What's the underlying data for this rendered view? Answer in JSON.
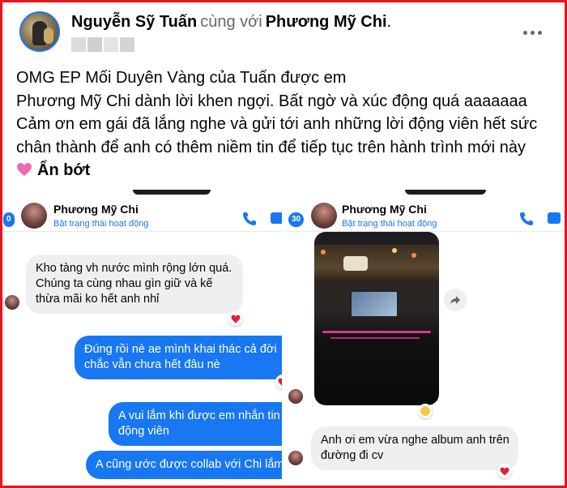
{
  "post": {
    "author": "Nguyễn Sỹ Tuấn",
    "with_word": "cùng với",
    "co_author": "Phương Mỹ Chi",
    "end_dot": ".",
    "text_lines": [
      "OMG EP Mối Duyên Vàng của Tuấn được em",
      "Phương Mỹ Chi dành lời khen ngợi. Bất ngờ và xúc động quá aaaaaaa",
      "Cảm ơn em gái đã lắng nghe và gửi tới anh những lời động viên hết sức",
      "chân thành để anh có thêm niềm tin để tiếp tục trên hành trình mới này"
    ],
    "see_less": "Ẩn bớt",
    "frame_color": "#e5161c"
  },
  "left_screenshot": {
    "back_count": "0",
    "contact_name": "Phương Mỹ Chi",
    "status": "Bật trạng thái hoạt động",
    "messages": [
      {
        "type": "received",
        "lines": [
          "Kho tàng vh nước mình rộng lớn quá.",
          "Chúng ta cùng nhau gìn giữ và kế",
          "thừa mãi ko hết anh nhỉ"
        ],
        "reaction": "heart"
      },
      {
        "type": "sent",
        "lines": [
          "Đúng rồi nè ae mình khai thác cả đời",
          "chắc vẫn chưa hết đâu nè"
        ],
        "reaction": "heart"
      },
      {
        "type": "sent",
        "lines": [
          "A vui lắm khi được em nhắn tin",
          "động viên"
        ]
      },
      {
        "type": "sent",
        "lines": [
          "A cũng ước được collab với Chi lắm"
        ]
      }
    ]
  },
  "right_screenshot": {
    "back_count": "30",
    "contact_name": "Phương Mỹ Chi",
    "status": "Bật trạng thái hoạt động",
    "messages": [
      {
        "type": "video",
        "reaction": "wow"
      },
      {
        "type": "received",
        "lines": [
          "Anh ơi em vừa nghe album anh trên",
          "đường đi cv"
        ],
        "reaction": "heart"
      }
    ]
  },
  "colors": {
    "messenger_blue": "#1877f2",
    "received_bubble": "#eeeff1",
    "heart_red": "#e41e3f"
  }
}
